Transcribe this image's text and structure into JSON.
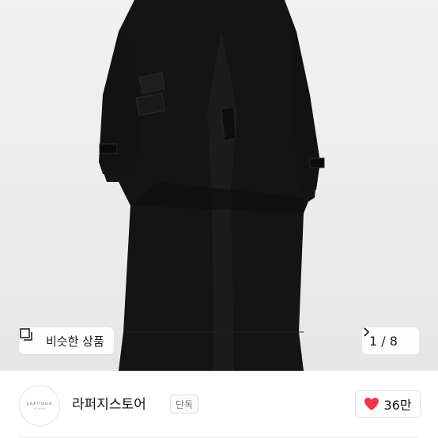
{
  "product": {
    "similar_label": "비슷한 상품",
    "page_indicator": "1 / 8"
  },
  "store": {
    "logo_text": "LAFUDGE",
    "logo_subtext": "STORE",
    "name": "라퍼지스토어",
    "badge": "단독",
    "like_count": "36만"
  },
  "colors": {
    "heart": "#f0384a",
    "coat": "#151515"
  },
  "icons": [
    "similar-items-icon",
    "chevron-right-icon",
    "heart-icon"
  ]
}
